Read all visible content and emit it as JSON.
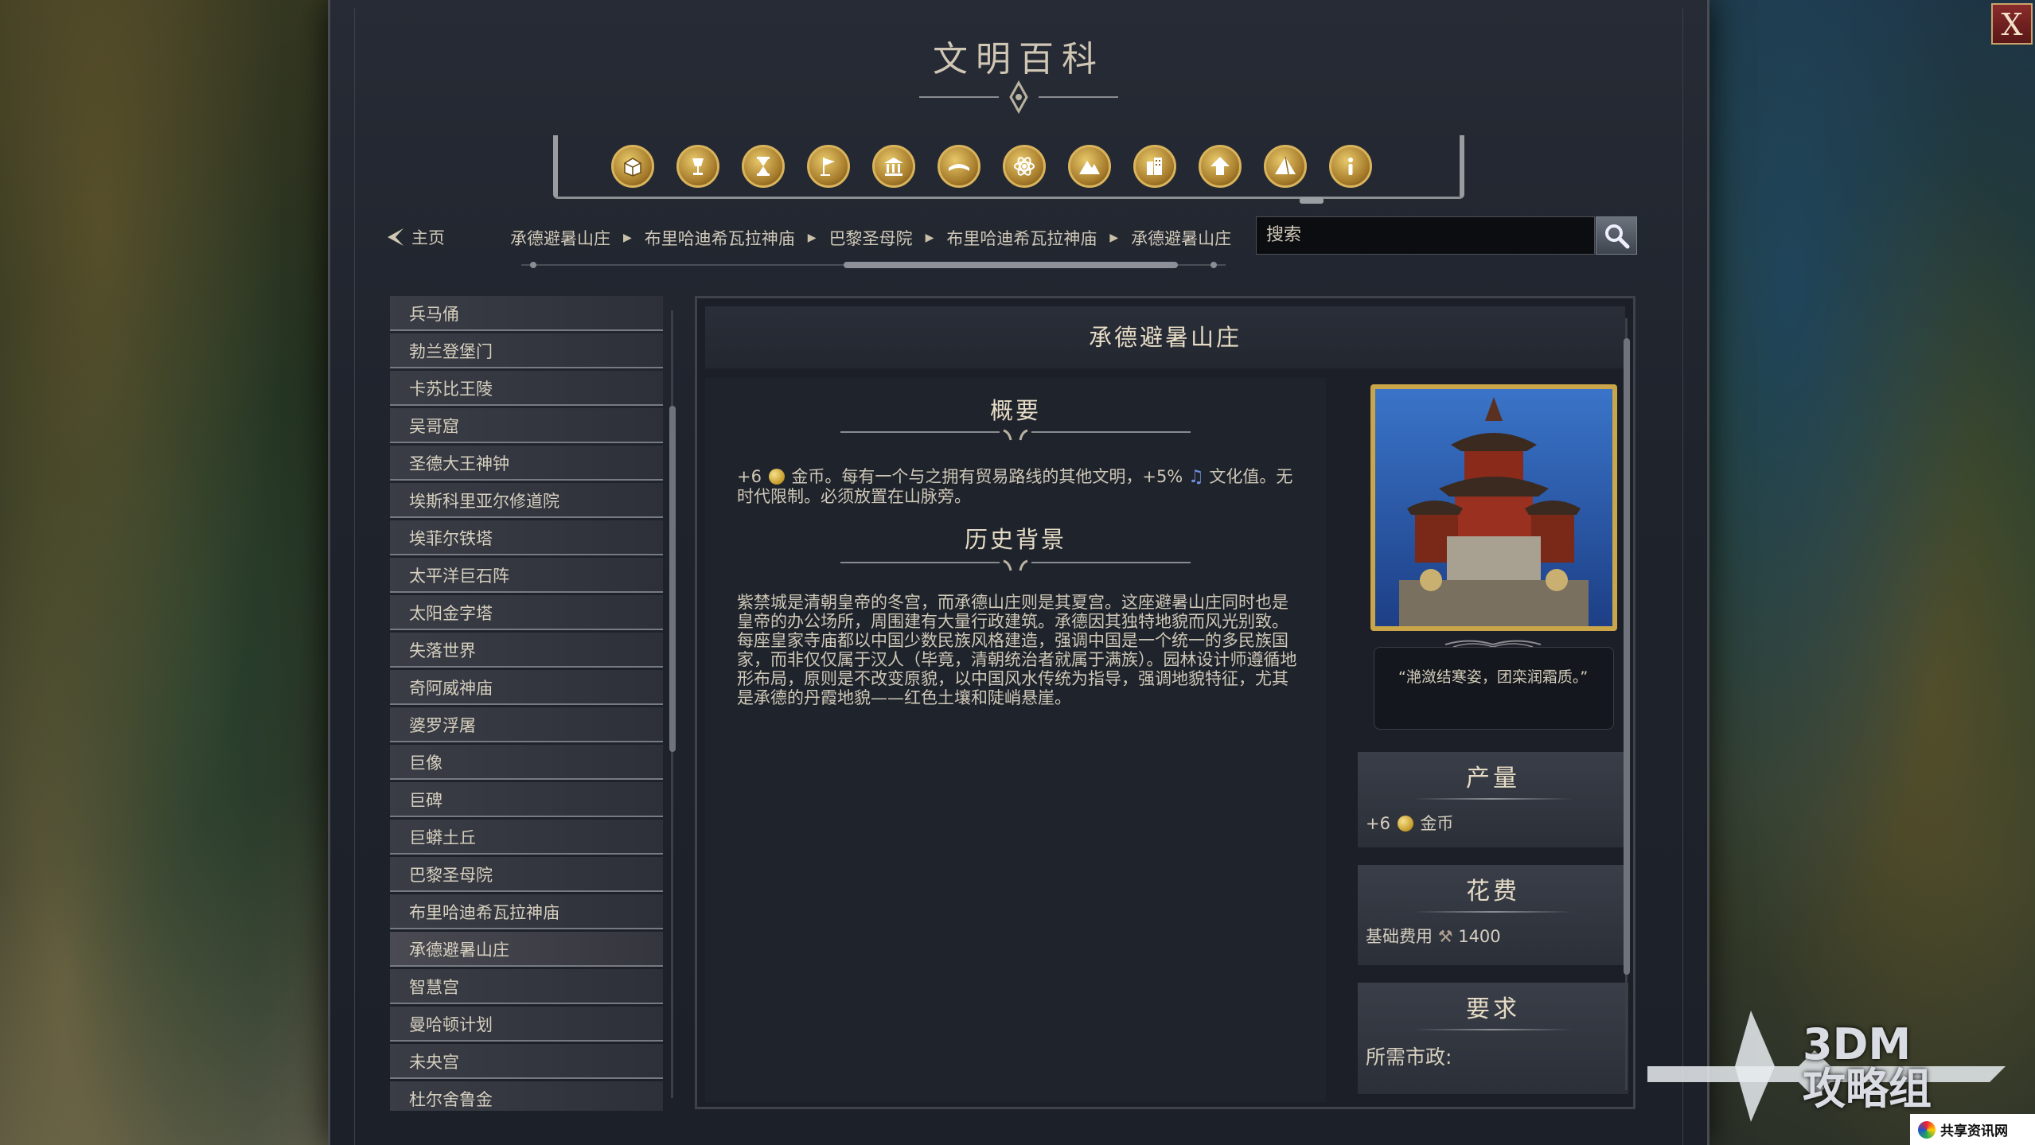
{
  "window": {
    "title": "文明百科",
    "close_label": "X"
  },
  "categories": [
    {
      "icon": "crate-icon"
    },
    {
      "icon": "goblet-icon"
    },
    {
      "icon": "hourglass-icon"
    },
    {
      "icon": "flag-icon"
    },
    {
      "icon": "government-building-icon"
    },
    {
      "icon": "book-icon"
    },
    {
      "icon": "atom-icon"
    },
    {
      "icon": "mountain-icon"
    },
    {
      "icon": "city-icon"
    },
    {
      "icon": "upgrade-arrow-icon"
    },
    {
      "icon": "pyramid-icon"
    },
    {
      "icon": "info-icon"
    }
  ],
  "nav": {
    "home_label": "主页",
    "breadcrumbs": [
      "承德避暑山庄",
      "布里哈迪希瓦拉神庙",
      "巴黎圣母院",
      "布里哈迪希瓦拉神庙",
      "承德避暑山庄"
    ],
    "search_placeholder": "搜索"
  },
  "list": {
    "items": [
      "兵马俑",
      "勃兰登堡门",
      "卡苏比王陵",
      "吴哥窟",
      "圣德大王神钟",
      "埃斯科里亚尔修道院",
      "埃菲尔铁塔",
      "太平洋巨石阵",
      "太阳金字塔",
      "失落世界",
      "奇阿威神庙",
      "婆罗浮屠",
      "巨像",
      "巨碑",
      "巨蟒土丘",
      "巴黎圣母院",
      "布里哈迪希瓦拉神庙",
      "承德避暑山庄",
      "智慧宫",
      "曼哈顿计划",
      "未央宫",
      "杜尔舍鲁金"
    ],
    "selected_index": 17
  },
  "article": {
    "title": "承德避暑山庄",
    "overview_title": "概要",
    "overview_pre": "+6",
    "overview_coin_word": "金币。每有一个与之拥有贸易路线的其他文明，+5%",
    "overview_post": "文化值。无时代限制。必须放置在山脉旁。",
    "history_title": "历史背景",
    "history_text": "紫禁城是清朝皇帝的冬宫，而承德山庄则是其夏宫。这座避暑山庄同时也是皇帝的办公场所，周围建有大量行政建筑。承德因其独特地貌而风光别致。每座皇家寺庙都以中国少数民族风格建造，强调中国是一个统一的多民族国家，而非仅仅属于汉人（毕竟，清朝统治者就属于满族）。园林设计师遵循地形布局，原则是不改变原貌，以中国风水传统为指导，强调地貌特征，尤其是承德的丹霞地貌——红色土壤和陡峭悬崖。",
    "quote": "“滟潋结寒姿，团栾润霜质。”"
  },
  "stats": {
    "production_title": "产量",
    "production_value": "+6",
    "production_unit": "金币",
    "cost_title": "花费",
    "cost_label": "基础费用",
    "cost_value": "1400",
    "requirement_title": "要求",
    "requirement_label": "所需市政:"
  },
  "watermark": {
    "brand_top": "3DM",
    "brand_bottom": "攻略组",
    "site": "共享资讯网"
  },
  "colors": {
    "accent_gold": "#c9a64a",
    "panel_bg": "#1f232b",
    "close_red": "#8a2b2b"
  }
}
